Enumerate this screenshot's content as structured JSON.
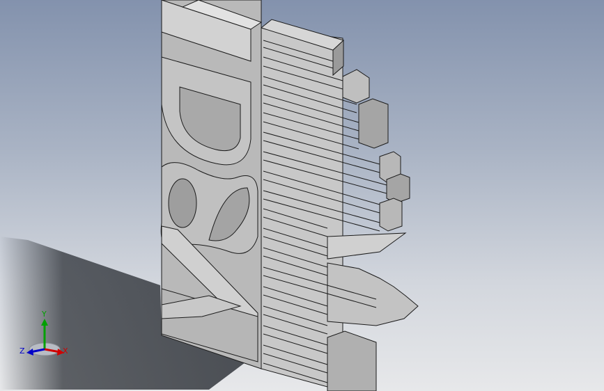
{
  "viewport": {
    "background_top": "#8392ad",
    "background_bottom": "#e7e8ea"
  },
  "model": {
    "color_face_light": "#c9c9c9",
    "color_face_mid": "#b4b4b4",
    "color_face_dark": "#8a8a8a",
    "edge_color": "#1a1a1a"
  },
  "triad": {
    "x_label": "X",
    "y_label": "Y",
    "z_label": "Z",
    "x_color": "#d10000",
    "y_color": "#00a000",
    "z_color": "#0000c8"
  }
}
